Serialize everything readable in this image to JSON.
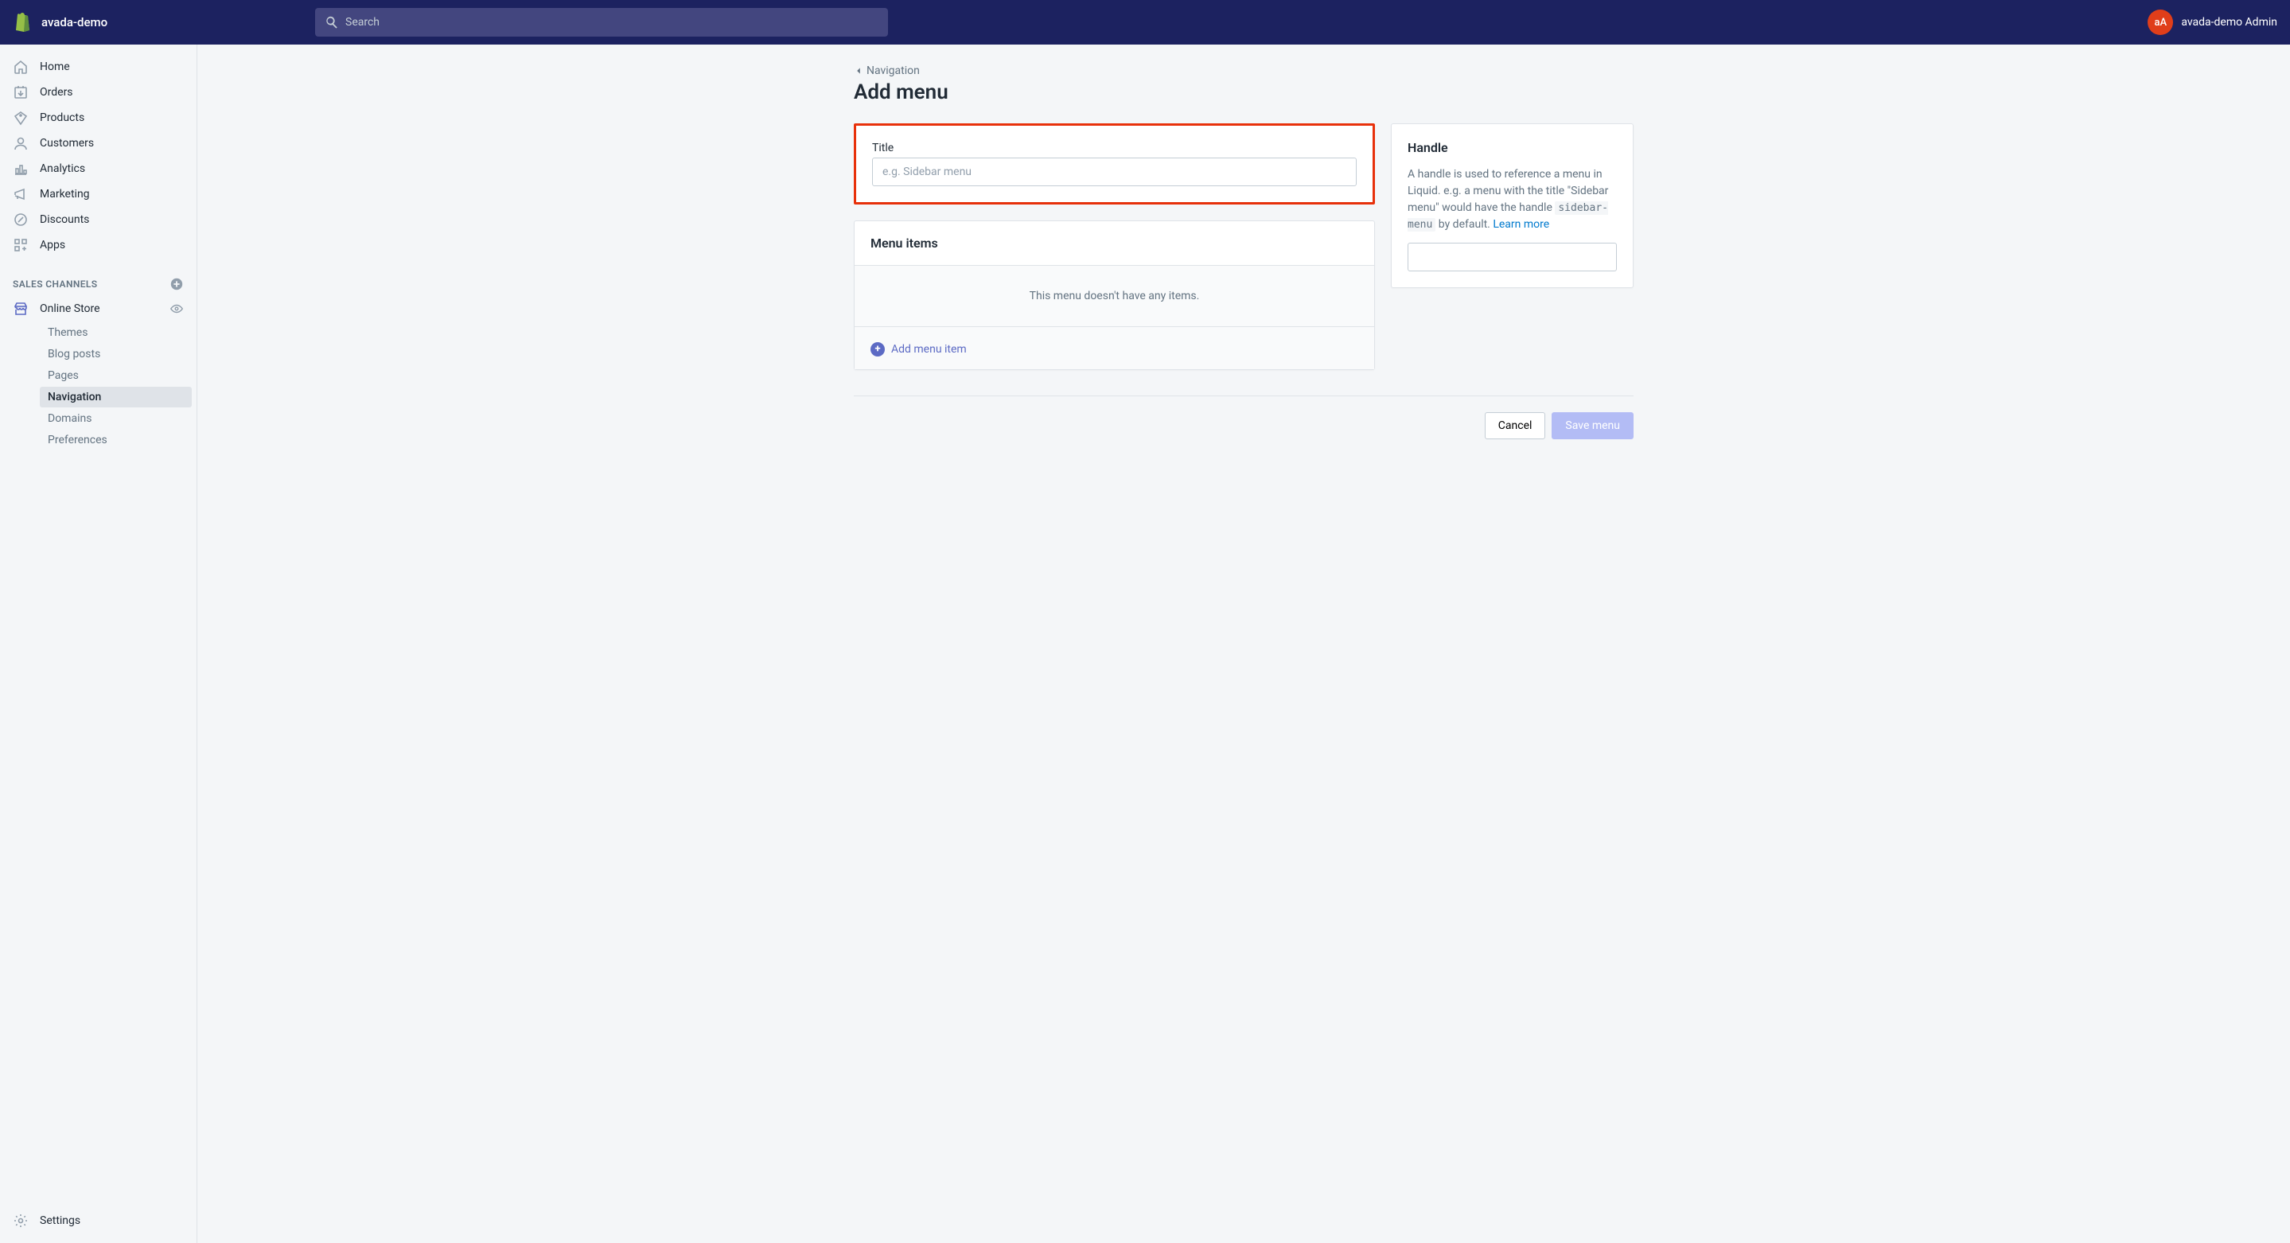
{
  "topbar": {
    "shop_name": "avada-demo",
    "search_placeholder": "Search",
    "avatar_initials": "aA",
    "user_name": "avada-demo Admin"
  },
  "sidebar": {
    "items": [
      {
        "label": "Home",
        "icon": "home-icon"
      },
      {
        "label": "Orders",
        "icon": "orders-icon"
      },
      {
        "label": "Products",
        "icon": "products-icon"
      },
      {
        "label": "Customers",
        "icon": "customers-icon"
      },
      {
        "label": "Analytics",
        "icon": "analytics-icon"
      },
      {
        "label": "Marketing",
        "icon": "marketing-icon"
      },
      {
        "label": "Discounts",
        "icon": "discounts-icon"
      },
      {
        "label": "Apps",
        "icon": "apps-icon"
      }
    ],
    "section_header": "SALES CHANNELS",
    "channel": {
      "label": "Online Store"
    },
    "subnav": [
      {
        "label": "Themes"
      },
      {
        "label": "Blog posts"
      },
      {
        "label": "Pages"
      },
      {
        "label": "Navigation",
        "selected": true
      },
      {
        "label": "Domains"
      },
      {
        "label": "Preferences"
      }
    ],
    "footer": {
      "label": "Settings"
    }
  },
  "page": {
    "breadcrumb": "Navigation",
    "title": "Add menu",
    "title_field": {
      "label": "Title",
      "placeholder": "e.g. Sidebar menu",
      "value": ""
    },
    "menu_items": {
      "header": "Menu items",
      "empty": "This menu doesn't have any items.",
      "add_label": "Add menu item"
    },
    "handle_card": {
      "title": "Handle",
      "text_before": "A handle is used to reference a menu in Liquid. e.g. a menu with the title \"Sidebar menu\" would have the handle ",
      "code": "sidebar-menu",
      "text_after": " by default. ",
      "learn_more": "Learn more",
      "value": ""
    },
    "actions": {
      "cancel": "Cancel",
      "save": "Save menu"
    }
  }
}
